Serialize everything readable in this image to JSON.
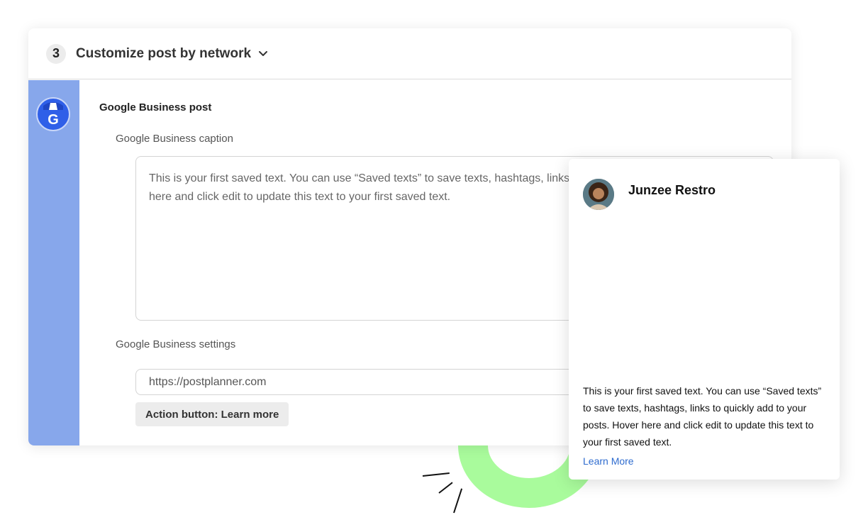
{
  "colors": {
    "sidebar": "#87a7eb",
    "google_icon": "#2f5fe8",
    "ring": "#a9fb9c",
    "link": "#2f6ccf"
  },
  "header": {
    "step_number": "3",
    "title": "Customize post by network",
    "dropdown_icon": "chevron-down-icon"
  },
  "sidebar": {
    "network_icon": "google-business-icon",
    "network_letter": "G"
  },
  "post": {
    "section_title": "Google Business post",
    "caption_label": "Google Business caption",
    "caption_text": "This is your first saved text. You can use “Saved texts” to save texts, hashtags, links to quickly add to your posts. Hover here and click edit to update this text to your first saved text.",
    "settings_label": "Google Business settings",
    "url_value": "https://postplanner.com",
    "action_button": "Action button: Learn more"
  },
  "preview": {
    "profile_name": "Junzee Restro",
    "text": "This is your first saved text. You can use “Saved texts” to save texts, hashtags, links to quickly add to your posts. Hover here and click edit to update this text to your first saved text.",
    "link_label": "Learn More"
  }
}
